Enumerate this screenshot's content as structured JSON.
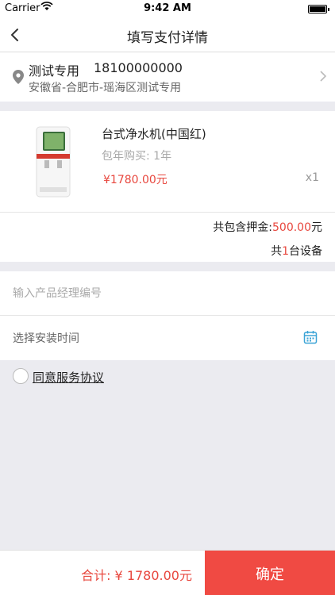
{
  "status_bar": {
    "carrier": "Carrier",
    "time": "9:42 AM"
  },
  "nav": {
    "title": "填写支付详情"
  },
  "address": {
    "name": "测试专用",
    "phone": "18100000000",
    "detail": "安徽省-合肥市-瑶海区测试专用"
  },
  "product": {
    "name": "台式净水机(中国红)",
    "plan": "包年购买: 1年",
    "price": "¥1780.00元",
    "quantity": "x1"
  },
  "summary": {
    "deposit_prefix": "共包含押金:",
    "deposit_amount": "500.00",
    "deposit_unit": "元",
    "count_prefix": "共",
    "count_value": "1",
    "count_suffix": "台设备"
  },
  "form": {
    "manager_placeholder": "输入产品经理编号",
    "install_label": "选择安装时间"
  },
  "agreement": {
    "label": "同意服务协议"
  },
  "footer": {
    "total": "合计: ¥ 1780.00元",
    "confirm_label": "确定"
  },
  "colors": {
    "accent": "#f04a43",
    "price": "#e8473e",
    "calendar": "#3aa3d6"
  },
  "icons": [
    "back-arrow-icon",
    "location-pin-icon",
    "chevron-right-icon",
    "calendar-icon",
    "wifi-icon",
    "battery-icon"
  ]
}
